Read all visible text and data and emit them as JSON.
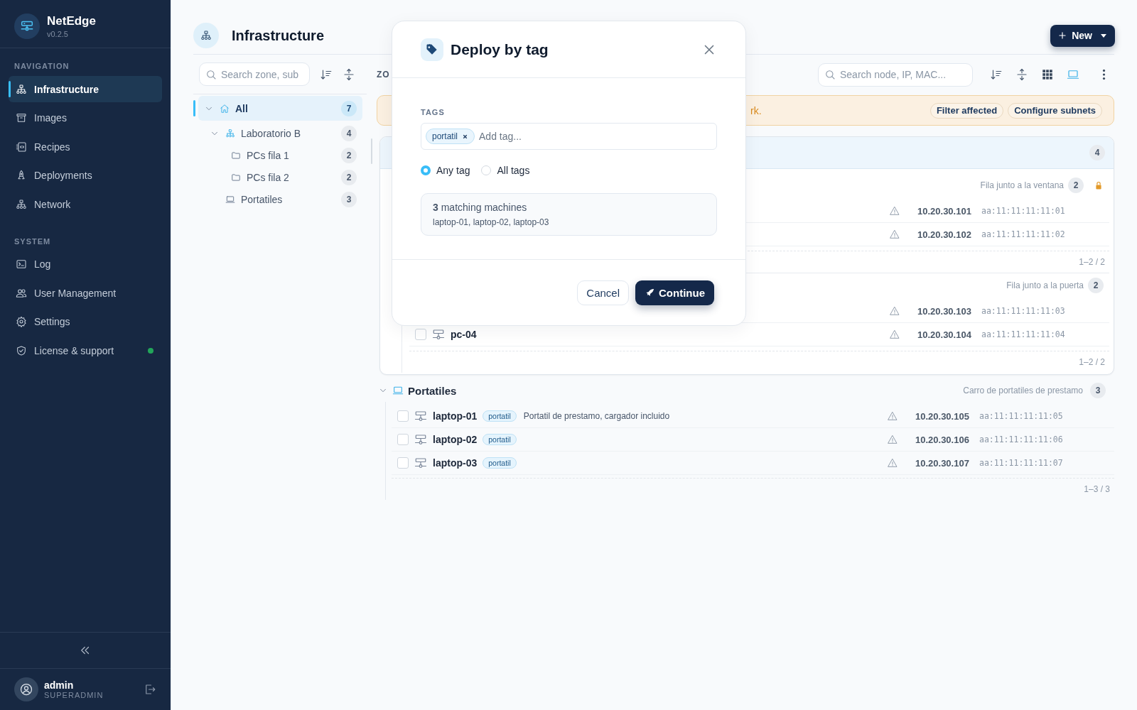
{
  "sidebar": {
    "brand": {
      "name": "NetEdge",
      "version": "v0.2.5"
    },
    "sections": [
      {
        "heading": "NAVIGATION",
        "items": [
          {
            "label": "Infrastructure",
            "selected": true
          },
          {
            "label": "Images",
            "selected": false
          },
          {
            "label": "Recipes",
            "selected": false
          },
          {
            "label": "Deployments",
            "selected": false
          },
          {
            "label": "Network",
            "selected": false
          }
        ]
      },
      {
        "heading": "SYSTEM",
        "items": [
          {
            "label": "Log",
            "selected": false
          },
          {
            "label": "User Management",
            "selected": false
          },
          {
            "label": "Settings",
            "selected": false
          },
          {
            "label": "License & support",
            "selected": false,
            "color": "#22a55a"
          }
        ]
      }
    ],
    "user": {
      "name": "admin",
      "role": "SUPERADMIN"
    }
  },
  "header": {
    "title": "Infrastructure",
    "new_button": "New"
  },
  "tree": {
    "placeholder": "Search zone, sub",
    "items": [
      {
        "label": "All",
        "count": "7",
        "kind": "root",
        "selected": true,
        "expanded": true,
        "children": [
          {
            "label": "Laboratorio B",
            "count": "4",
            "kind": "zone",
            "selected": false,
            "expanded": true,
            "children": [
              {
                "label": "PCs fila 1",
                "count": "2",
                "kind": "folder",
                "selected": false
              },
              {
                "label": "PCs fila 2",
                "count": "2",
                "kind": "folder",
                "selected": false
              }
            ]
          },
          {
            "label": "Portatiles",
            "count": "3",
            "kind": "laptops",
            "selected": false
          }
        ]
      }
    ]
  },
  "toolbar": {
    "label": "ZO",
    "placeholder": "Search node, IP, MAC...",
    "views": [
      {
        "selected": false
      },
      {
        "selected": true
      }
    ]
  },
  "banner": {
    "text": "rk.",
    "actions": [
      "Filter affected",
      "Configure subnets"
    ]
  },
  "zone": {
    "count": "4",
    "groups": [
      {
        "note": "Fila junto a la ventana",
        "count": "2",
        "locked": true,
        "range": "1–2 / 2",
        "rows": [
          {
            "warning": true,
            "ip": "10.20.30.101",
            "mac": "aa:11:11:11:11:01"
          },
          {
            "warning": true,
            "ip": "10.20.30.102",
            "mac": "aa:11:11:11:11:02"
          }
        ]
      },
      {
        "note": "Fila junto a la puerta",
        "count": "2",
        "locked": false,
        "range": "1–2 / 2",
        "rows": [
          {
            "warning": true,
            "ip": "10.20.30.103",
            "mac": "aa:11:11:11:11:03"
          },
          {
            "name": "pc-04",
            "checked": false,
            "warning": true,
            "ip": "10.20.30.104",
            "mac": "aa:11:11:11:11:04"
          }
        ]
      }
    ]
  },
  "section": {
    "title": "Portatiles",
    "note": "Carro de portatiles de prestamo",
    "count": "3",
    "expanded": true,
    "range": "1–3 / 3",
    "rows": [
      {
        "name": "laptop-01",
        "tag": "portatil",
        "description": "Portatil de prestamo, cargador incluido",
        "checked": false,
        "warning": true,
        "ip": "10.20.30.105",
        "mac": "aa:11:11:11:11:05"
      },
      {
        "name": "laptop-02",
        "tag": "portatil",
        "checked": false,
        "warning": true,
        "ip": "10.20.30.106",
        "mac": "aa:11:11:11:11:06"
      },
      {
        "name": "laptop-03",
        "tag": "portatil",
        "checked": false,
        "warning": true,
        "ip": "10.20.30.107",
        "mac": "aa:11:11:11:11:07"
      }
    ]
  },
  "modal": {
    "title": "Deploy by tag",
    "tags_label": "TAGS",
    "tags": [
      "portatil"
    ],
    "placeholder": "Add tag...",
    "modes": [
      {
        "label": "Any tag",
        "selected": true
      },
      {
        "label": "All tags",
        "selected": false
      }
    ],
    "match": {
      "count": "3",
      "label": "matching machines",
      "names": "laptop-01, laptop-02, laptop-03"
    },
    "cancel": "Cancel",
    "continue": "Continue"
  }
}
